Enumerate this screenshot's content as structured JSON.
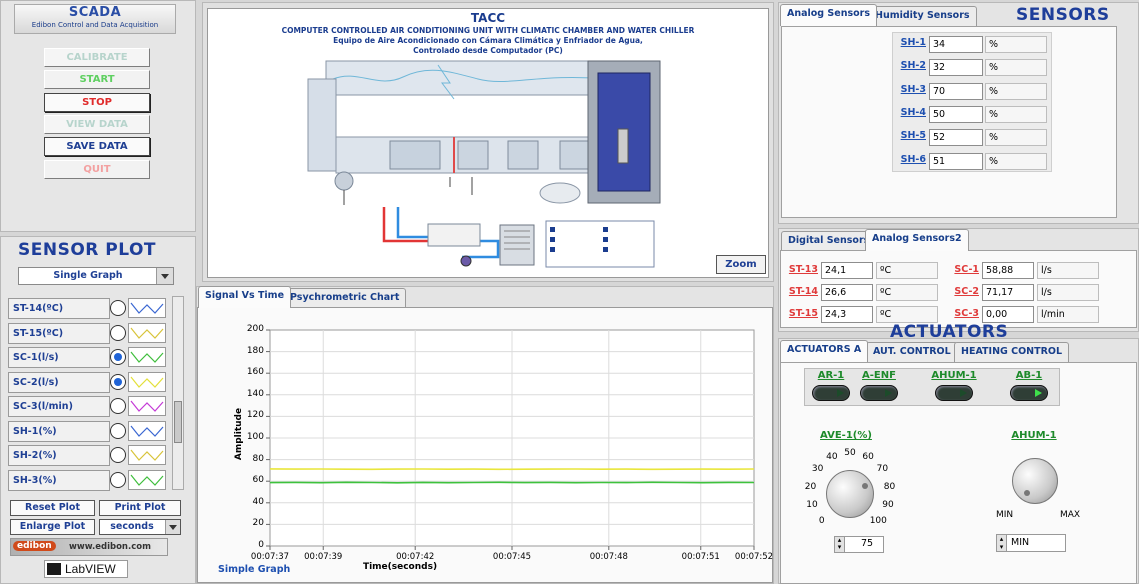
{
  "app": {
    "title": "SCADA",
    "subtitle": "Edibon Control and Data Acquisition"
  },
  "controls": {
    "calibrate": "CALIBRATE",
    "start": "START",
    "stop": "STOP",
    "view_data": "VIEW DATA",
    "save_data": "SAVE DATA",
    "quit": "QUIT"
  },
  "sensor_plot": {
    "title": "SENSOR PLOT",
    "mode": "Single Graph",
    "items": [
      {
        "label": "ST-14(ºC)",
        "selected": false,
        "color": "#3a67d2"
      },
      {
        "label": "ST-15(ºC)",
        "selected": false,
        "color": "#d8c43a"
      },
      {
        "label": "SC-1(l/s)",
        "selected": true,
        "color": "#3fbe3c"
      },
      {
        "label": "SC-2(l/s)",
        "selected": true,
        "color": "#e3e03a"
      },
      {
        "label": "SC-3(l/min)",
        "selected": false,
        "color": "#c43ad6"
      },
      {
        "label": "SH-1(%)",
        "selected": false,
        "color": "#3a67d2"
      },
      {
        "label": "SH-2(%)",
        "selected": false,
        "color": "#d8c43a"
      },
      {
        "label": "SH-3(%)",
        "selected": false,
        "color": "#3fbe3c"
      }
    ],
    "reset": "Reset Plot",
    "print": "Print Plot",
    "enlarge": "Enlarge Plot",
    "units": "seconds"
  },
  "brand": {
    "site": "www.edibon.com",
    "labview": "LabVIEW",
    "edibon": "edibon"
  },
  "diagram": {
    "title": "TACC",
    "line1": "COMPUTER CONTROLLED AIR CONDITIONING UNIT WITH CLIMATIC CHAMBER AND WATER CHILLER",
    "line2": "Equipo de Aire Acondicionado con Cámara Climática y Enfriador de Agua,",
    "line3": "Controlado desde Computador (PC)",
    "zoom": "Zoom"
  },
  "graph": {
    "tabs": [
      "Signal Vs Time",
      "Psychrometric Chart"
    ],
    "footer": "Simple Graph"
  },
  "chart_data": {
    "type": "line",
    "title": "",
    "xlabel": "Time(seconds)",
    "ylabel": "Amplitude",
    "ylim": [
      0,
      200
    ],
    "yticks": [
      0,
      20,
      40,
      60,
      80,
      100,
      120,
      140,
      160,
      180,
      200
    ],
    "x_tick_labels": [
      "00:07:37",
      "00:07:39",
      "00:07:42",
      "00:07:45",
      "00:07:48",
      "00:07:51",
      "00:07:52"
    ],
    "x_tick_pos": [
      0,
      0.11,
      0.3,
      0.5,
      0.7,
      0.89,
      1
    ],
    "grid": true,
    "series": [
      {
        "color": "#e9e63b",
        "values": [
          71.4,
          71.2,
          71.3,
          71.1,
          71.0,
          71.2,
          71.3,
          71.1,
          71.2,
          71.0,
          71.1,
          71.2,
          71.3,
          71.1,
          71.2,
          71.0,
          71.1,
          71.2,
          71.1,
          71.3
        ]
      },
      {
        "color": "#3ec23d",
        "values": [
          58.7,
          58.9,
          58.6,
          59.0,
          58.8,
          58.5,
          58.9,
          58.6,
          58.8,
          59.0,
          58.7,
          58.9,
          58.6,
          58.8,
          58.7,
          59.0,
          58.8,
          58.6,
          58.9,
          58.8
        ]
      }
    ]
  },
  "sensors": {
    "title": "SENSORS",
    "tabs_top": [
      "Analog Sensors",
      "Humidity Sensors"
    ],
    "humidity": [
      {
        "id": "SH-1",
        "value": "34",
        "unit": "%"
      },
      {
        "id": "SH-2",
        "value": "32",
        "unit": "%"
      },
      {
        "id": "SH-3",
        "value": "70",
        "unit": "%"
      },
      {
        "id": "SH-4",
        "value": "50",
        "unit": "%"
      },
      {
        "id": "SH-5",
        "value": "52",
        "unit": "%"
      },
      {
        "id": "SH-6",
        "value": "51",
        "unit": "%"
      }
    ],
    "tabs_mid": [
      "Digital Sensors",
      "Analog Sensors2"
    ],
    "analog2_left": [
      {
        "id": "ST-13",
        "value": "24,1",
        "unit": "ºC"
      },
      {
        "id": "ST-14",
        "value": "26,6",
        "unit": "ºC"
      },
      {
        "id": "ST-15",
        "value": "24,3",
        "unit": "ºC"
      }
    ],
    "analog2_right": [
      {
        "id": "SC-1",
        "value": "58,88",
        "unit": "l/s"
      },
      {
        "id": "SC-2",
        "value": "71,17",
        "unit": "l/s"
      },
      {
        "id": "SC-3",
        "value": "0,00",
        "unit": "l/min"
      }
    ]
  },
  "actuators": {
    "title": "ACTUATORS",
    "tabs": [
      "ACTUATORS A",
      "AUT. CONTROL",
      "HEATING CONTROL"
    ],
    "switches": [
      {
        "id": "AR-1",
        "on": false
      },
      {
        "id": "A-ENF",
        "on": false
      },
      {
        "id": "AHUM-1",
        "on": false
      },
      {
        "id": "AB-1",
        "on": true
      }
    ],
    "ave": {
      "label": "AVE-1(%)",
      "value": "75",
      "ticks": [
        "0",
        "10",
        "20",
        "30",
        "40",
        "50",
        "60",
        "70",
        "80",
        "90",
        "100"
      ]
    },
    "ahum": {
      "label": "AHUM-1",
      "min": "MIN",
      "max": "MAX",
      "value": "MIN"
    }
  }
}
